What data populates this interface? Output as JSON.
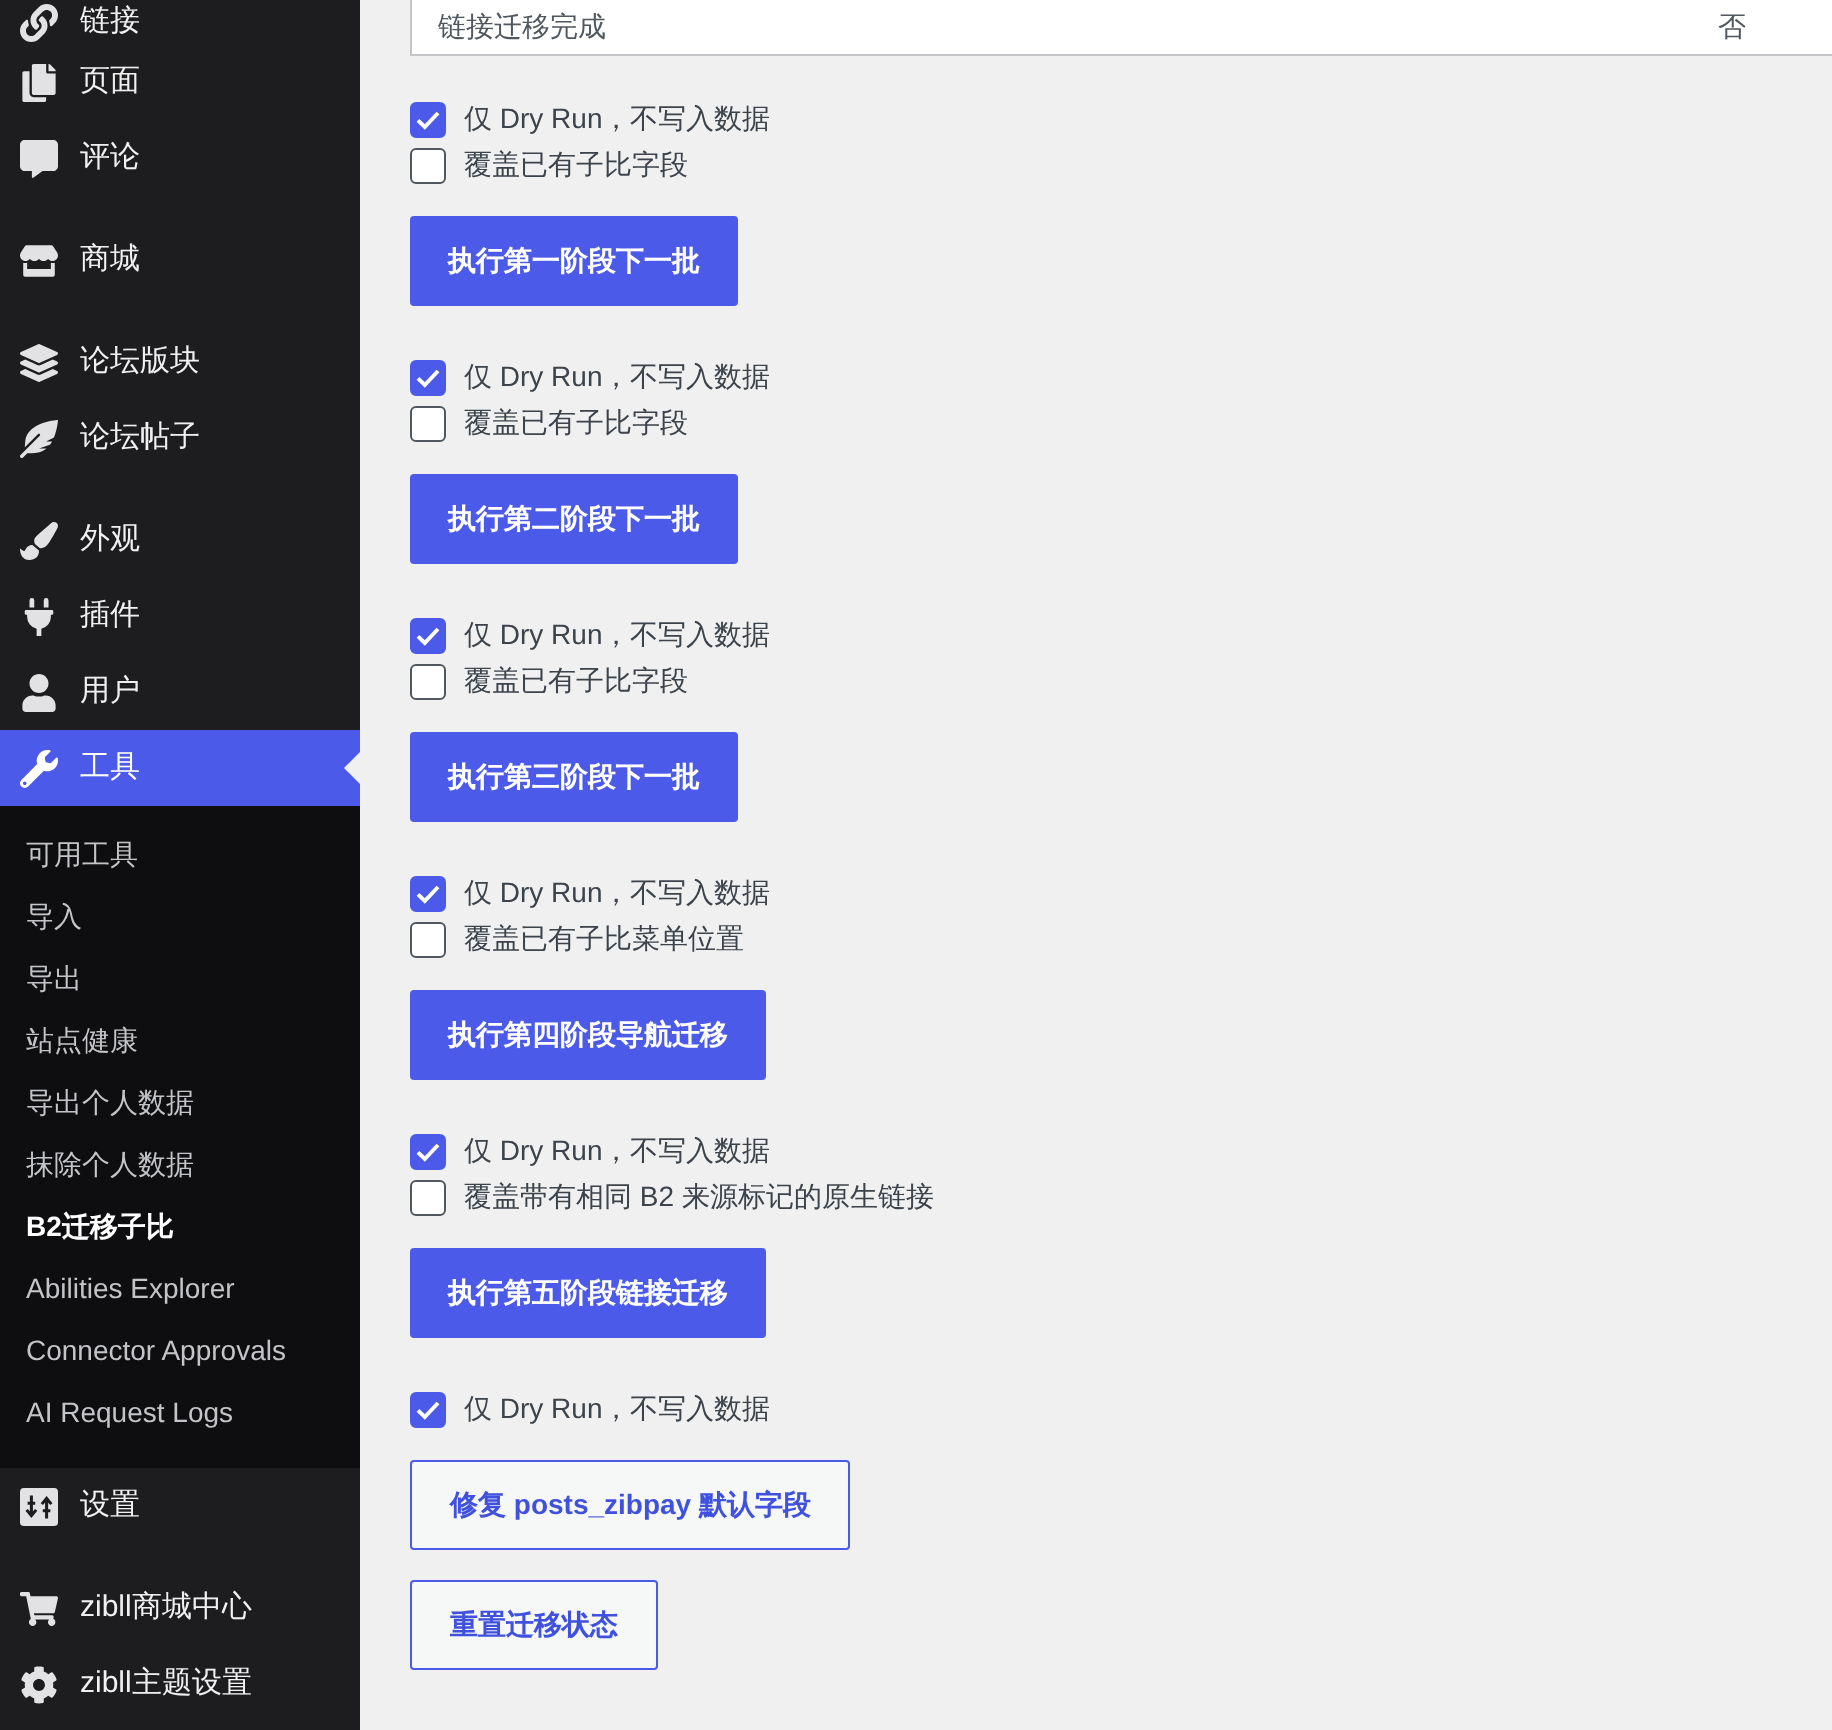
{
  "sidebar": {
    "groups": [
      {
        "items": [
          {
            "label": "链接",
            "selected": false
          },
          {
            "label": "页面",
            "selected": false
          },
          {
            "label": "评论",
            "selected": false
          }
        ]
      },
      {
        "items": [
          {
            "label": "商城",
            "selected": false
          }
        ]
      },
      {
        "items": [
          {
            "label": "论坛版块",
            "selected": false
          },
          {
            "label": "论坛帖子",
            "selected": false
          }
        ]
      },
      {
        "items": [
          {
            "label": "外观",
            "selected": false
          },
          {
            "label": "插件",
            "selected": false
          },
          {
            "label": "用户",
            "selected": false
          },
          {
            "label": "工具",
            "selected": true,
            "children": [
              {
                "label": "可用工具",
                "selected": false
              },
              {
                "label": "导入",
                "selected": false
              },
              {
                "label": "导出",
                "selected": false
              },
              {
                "label": "站点健康",
                "selected": false
              },
              {
                "label": "导出个人数据",
                "selected": false
              },
              {
                "label": "抹除个人数据",
                "selected": false
              },
              {
                "label": "B2迁移子比",
                "selected": true
              },
              {
                "label": "Abilities Explorer",
                "selected": false
              },
              {
                "label": "Connector Approvals",
                "selected": false
              },
              {
                "label": "AI Request Logs",
                "selected": false
              }
            ]
          },
          {
            "label": "设置",
            "selected": false
          }
        ]
      },
      {
        "items": [
          {
            "label": "zibll商城中心",
            "selected": false
          },
          {
            "label": "zibll主题设置",
            "selected": false
          }
        ]
      }
    ]
  },
  "status_table": {
    "rows": [
      {
        "label": "链接迁移完成",
        "value": "否"
      }
    ]
  },
  "sections": [
    {
      "options": [
        {
          "label": "仅 Dry Run，不写入数据",
          "checked": true
        },
        {
          "label": "覆盖已有子比字段",
          "checked": false
        }
      ],
      "button": {
        "label": "执行第一阶段下一批",
        "kind": "primary"
      }
    },
    {
      "options": [
        {
          "label": "仅 Dry Run，不写入数据",
          "checked": true
        },
        {
          "label": "覆盖已有子比字段",
          "checked": false
        }
      ],
      "button": {
        "label": "执行第二阶段下一批",
        "kind": "primary"
      }
    },
    {
      "options": [
        {
          "label": "仅 Dry Run，不写入数据",
          "checked": true
        },
        {
          "label": "覆盖已有子比字段",
          "checked": false
        }
      ],
      "button": {
        "label": "执行第三阶段下一批",
        "kind": "primary"
      }
    },
    {
      "options": [
        {
          "label": "仅 Dry Run，不写入数据",
          "checked": true
        },
        {
          "label": "覆盖已有子比菜单位置",
          "checked": false
        }
      ],
      "button": {
        "label": "执行第四阶段导航迁移",
        "kind": "primary"
      }
    },
    {
      "options": [
        {
          "label": "仅 Dry Run，不写入数据",
          "checked": true
        },
        {
          "label": "覆盖带有相同 B2 来源标记的原生链接",
          "checked": false
        }
      ],
      "button": {
        "label": "执行第五阶段链接迁移",
        "kind": "primary"
      }
    },
    {
      "options": [
        {
          "label": "仅 Dry Run，不写入数据",
          "checked": true
        }
      ],
      "button": {
        "label": "修复 posts_zibpay 默认字段",
        "kind": "secondary"
      }
    },
    {
      "button": {
        "label": "重置迁移状态",
        "kind": "secondary"
      }
    }
  ]
}
